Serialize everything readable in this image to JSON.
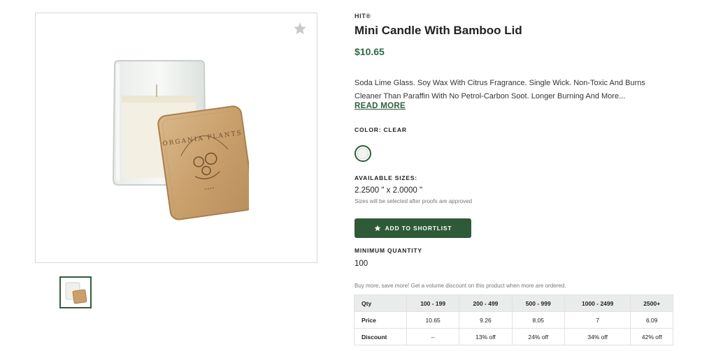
{
  "product": {
    "brand": "HIT®",
    "title": "Mini Candle With Bamboo Lid",
    "price": "$10.65",
    "description": "Soda Lime Glass. Soy Wax With Citrus Fragrance. Single Wick. Non-Toxic And Burns Cleaner Than Paraffin With No Petrol-Carbon Soot. Longer Burning And More...",
    "read_more": "READ MORE",
    "color_label": "COLOR: CLEAR",
    "sizes_label": "AVAILABLE SIZES:",
    "size_value": "2.2500 \" x 2.0000 \"",
    "size_note": "Sizes will be selected after proofs are approved",
    "shortlist_label": "ADD TO SHORTLIST",
    "min_qty_label": "MINIMUM QUANTITY",
    "min_qty_value": "100",
    "volume_note": "Buy more, save more! Get a volume discount on this product when more are ordered.",
    "lid_engraving": "ORGANIA PLANTS"
  },
  "pricing": {
    "headers": [
      "Qty",
      "100 - 199",
      "200 - 499",
      "500 - 999",
      "1000 - 2499",
      "2500+"
    ],
    "price_row": [
      "Price",
      "10.65",
      "9.26",
      "8.05",
      "7",
      "6.09"
    ],
    "discount_row": [
      "Discount",
      "--",
      "13% off",
      "24% off",
      "34% off",
      "42% off"
    ]
  },
  "icons": {
    "favorite": "star-icon",
    "shortlist": "star-icon"
  },
  "colors": {
    "accent": "#2e5a38",
    "price": "#2e6b3f",
    "table_header": "#e9ecea"
  }
}
